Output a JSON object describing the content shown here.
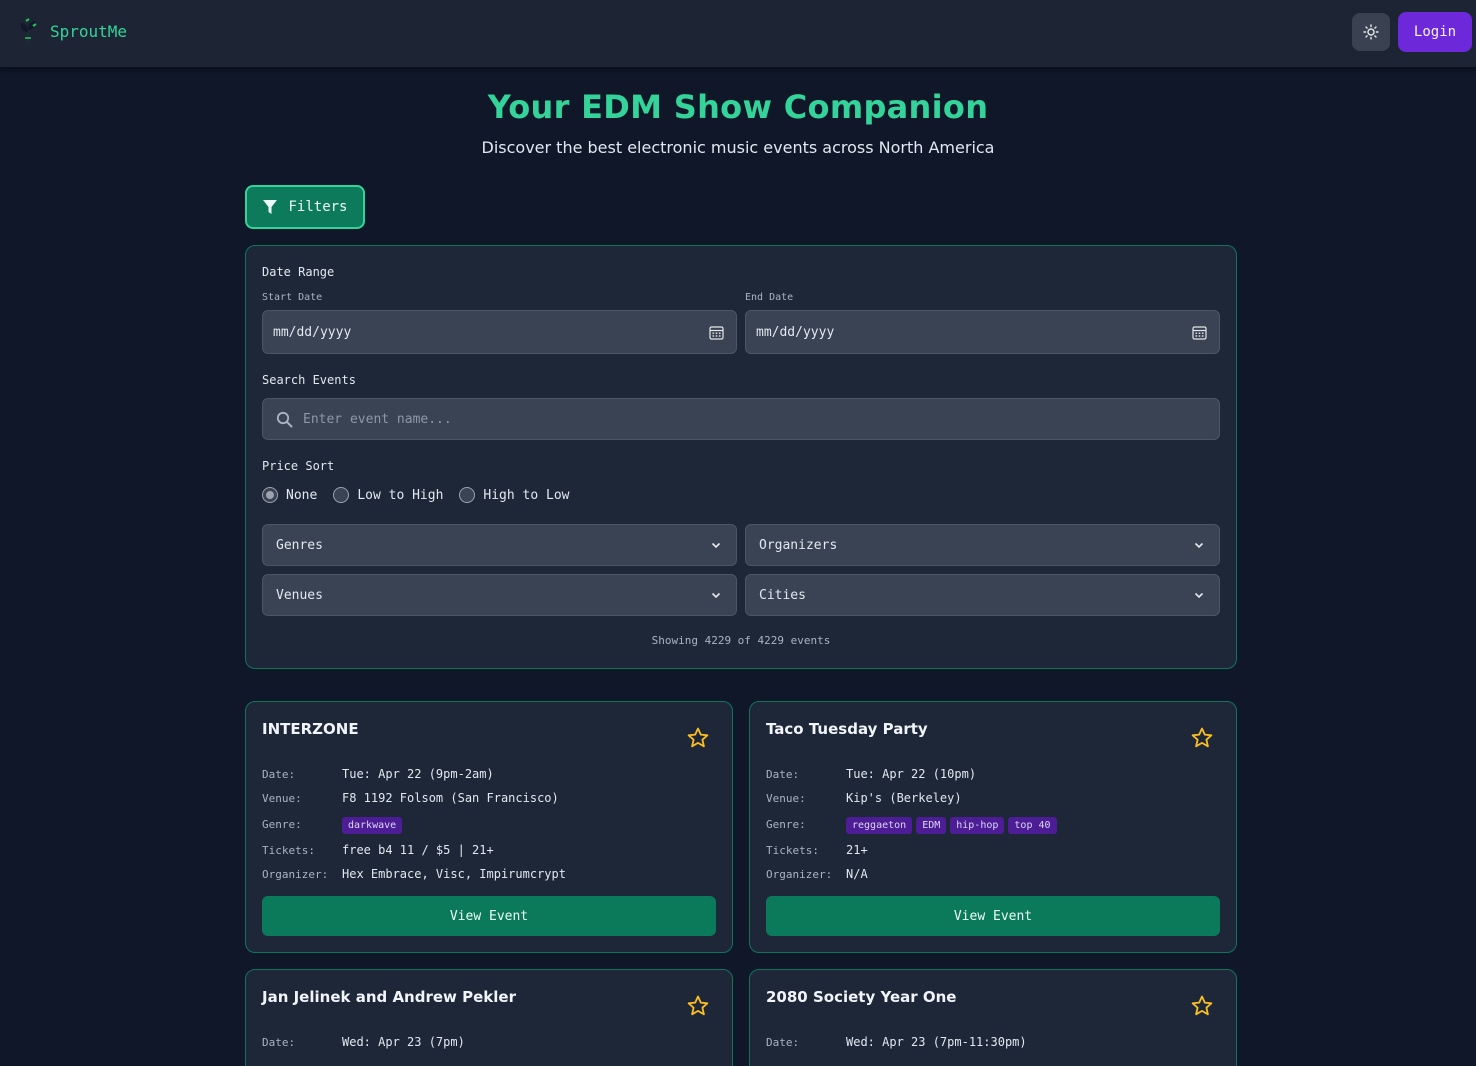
{
  "nav": {
    "brand": "SproutMe",
    "login_label": "Login"
  },
  "hero": {
    "title": "Your EDM Show Companion",
    "subtitle": "Discover the best electronic music events across North America"
  },
  "filters": {
    "button_label": "Filters",
    "date_range_label": "Date Range",
    "start_label": "Start Date",
    "end_label": "End Date",
    "start_value": "mm/dd/yyyy",
    "end_value": "mm/dd/yyyy",
    "search_label": "Search Events",
    "search_placeholder": "Enter event name...",
    "price_sort_label": "Price Sort",
    "price_options": [
      "None",
      "Low to High",
      "High to Low"
    ],
    "price_selected": "None",
    "genres": "Genres",
    "organizers": "Organizers",
    "venues": "Venues",
    "cities": "Cities",
    "count_text": "Showing 4229 of 4229 events"
  },
  "labels": {
    "date": "Date:",
    "venue": "Venue:",
    "genre": "Genre:",
    "tickets": "Tickets:",
    "organizer": "Organizer:",
    "view_event": "View Event"
  },
  "events": [
    {
      "title": "INTERZONE",
      "date": "Tue: Apr 22 (9pm-2am)",
      "venue": "F8 1192 Folsom (San Francisco)",
      "genres": [
        "darkwave"
      ],
      "tickets": "free b4 11 / $5 | 21+",
      "organizer": "Hex Embrace, Visc, Impirumcrypt"
    },
    {
      "title": "Taco Tuesday Party",
      "date": "Tue: Apr 22 (10pm)",
      "venue": "Kip's (Berkeley)",
      "genres": [
        "reggaeton",
        "EDM",
        "hip-hop",
        "top 40"
      ],
      "tickets": "21+",
      "organizer": "N/A"
    },
    {
      "title": "Jan Jelinek and Andrew Pekler",
      "date": "Wed: Apr 23 (7pm)"
    },
    {
      "title": "2080 Society Year One",
      "date": "Wed: Apr 23 (7pm-11:30pm)"
    }
  ]
}
